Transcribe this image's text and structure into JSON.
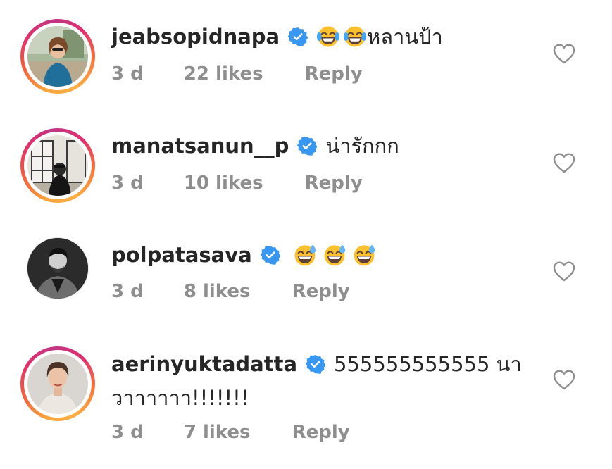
{
  "comments": [
    {
      "username": "jeabsopidnapa",
      "verified": true,
      "story_ring": true,
      "emoji_icons": [
        "face-with-tears-of-joy",
        "face-with-tears-of-joy"
      ],
      "text": "หลานป้า",
      "text_line2": "",
      "time": "3 d",
      "likes": "22 likes",
      "reply": "Reply"
    },
    {
      "username": "manatsanun__p",
      "verified": true,
      "story_ring": true,
      "emoji_icons": [],
      "text": "น่ารักกก",
      "text_line2": "",
      "time": "3 d",
      "likes": "10 likes",
      "reply": "Reply"
    },
    {
      "username": "polpatasava",
      "verified": true,
      "story_ring": false,
      "emoji_icons": [
        "grinning-face-with-sweat",
        "grinning-face-with-sweat",
        "grinning-face-with-sweat"
      ],
      "text": "",
      "text_line2": "",
      "time": "3 d",
      "likes": "8 likes",
      "reply": "Reply"
    },
    {
      "username": "aerinyuktadatta",
      "verified": true,
      "story_ring": true,
      "emoji_icons": [],
      "text": "555555555555 นา",
      "text_line2": "วาาาาาา!!!!!!!",
      "time": "3 d",
      "likes": "7 likes",
      "reply": "Reply"
    }
  ],
  "colors": {
    "text": "#262626",
    "meta": "#8e8e8e",
    "verified_blue": "#3897f0",
    "heart_stroke": "#8e8e8e"
  },
  "icons": {
    "verified": "verified-badge-icon",
    "like": "heart-outline-icon"
  }
}
